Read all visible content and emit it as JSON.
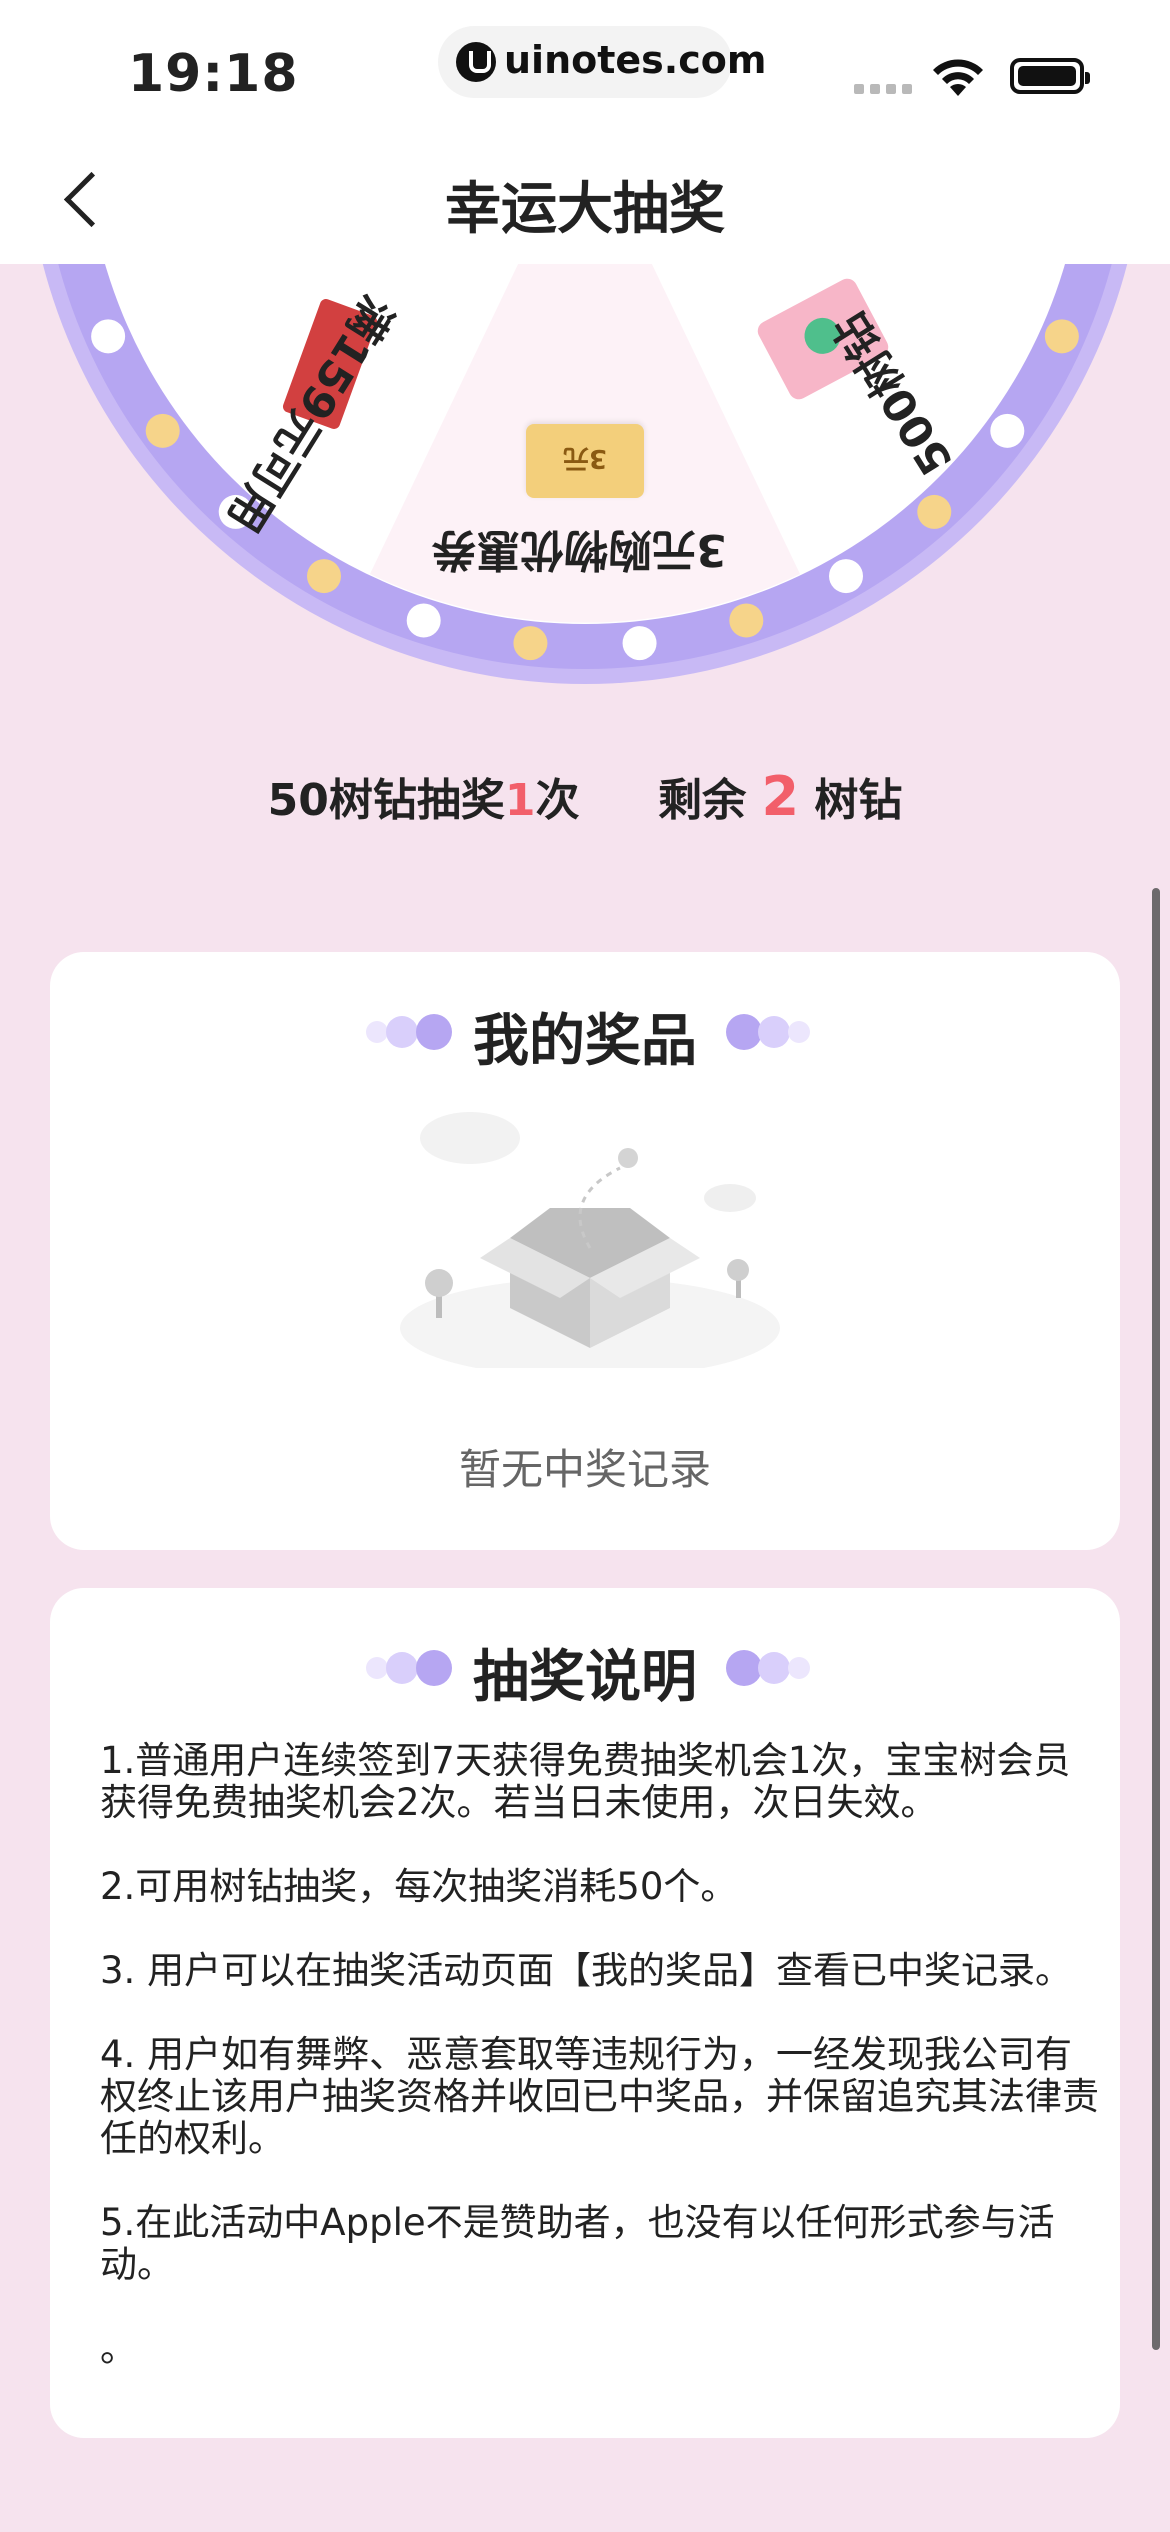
{
  "status_bar": {
    "time": "19:18",
    "url": "uinotes.com"
  },
  "nav": {
    "title": "幸运大抽奖",
    "back_icon": "chevron-left-icon"
  },
  "wheel": {
    "segments": [
      {
        "label": "3元购物优惠券",
        "coupon_text": "3元"
      },
      {
        "label": "满159元可用"
      },
      {
        "label": "500树钻"
      }
    ],
    "colors": {
      "rim": "#b6a6f2",
      "segment_light": "#fdf2f7",
      "dot_gold": "#f6d48a",
      "dot_white": "#ffffff"
    }
  },
  "draw_info": {
    "cost_prefix": "50树钻抽奖",
    "cost_count": "1",
    "cost_suffix": "次",
    "remaining_prefix": "剩余",
    "remaining_count": "2",
    "remaining_suffix": "树钻"
  },
  "prizes": {
    "title": "我的奖品",
    "empty_text": "暂无中奖记录"
  },
  "rules": {
    "title": "抽奖说明",
    "items": [
      "1.普通用户连续签到7天获得免费抽奖机会1次，宝宝树会员获得免费抽奖机会2次。若当日未使用，次日失效。",
      "2.可用树钻抽奖，每次抽奖消耗50个。",
      "3. 用户可以在抽奖活动页面【我的奖品】查看已中奖记录。",
      "4. 用户如有舞弊、恶意套取等违规行为，一经发现我公司有权终止该用户抽奖资格并收回已中奖品，并保留追究其法律责任的权利。",
      "5.在此活动中Apple不是赞助者，也没有以任何形式参与活动。",
      "。"
    ]
  },
  "theme": {
    "accent_red": "#f25f6a",
    "background": "#f6e3ee",
    "deco_purple": "#b6a6f2"
  }
}
